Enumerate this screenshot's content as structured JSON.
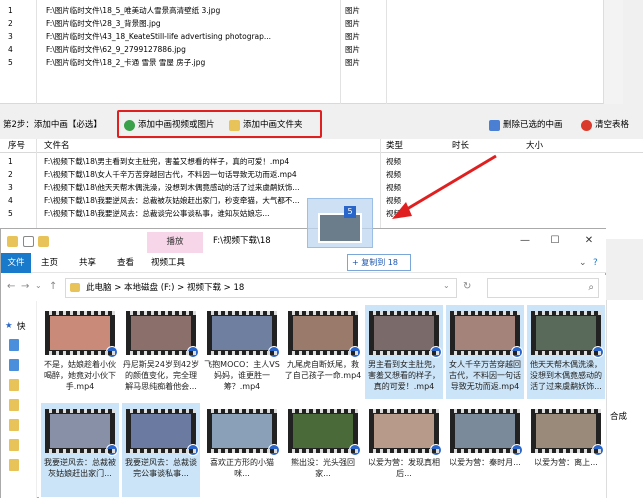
{
  "top_table": {
    "rows": [
      {
        "num": "1",
        "path": "F:\\图片临时文件\\18_5_唯美动人雪景高清壁纸 3.jpg",
        "type": "图片"
      },
      {
        "num": "2",
        "path": "F:\\图片临时文件\\28_3_背景图.jpg",
        "type": "图片"
      },
      {
        "num": "3",
        "path": "F:\\图片临时文件\\43_18_KeateStill-life advertising photograp...",
        "type": "图片"
      },
      {
        "num": "4",
        "path": "F:\\图片临时文件\\62_9_2799127886.jpg",
        "type": "图片"
      },
      {
        "num": "5",
        "path": "F:\\图片临时文件\\18_2_卡通 雪景 雪屋 房子.jpg",
        "type": "图片"
      }
    ]
  },
  "step2": {
    "label": "第2步：添加中画【必选】",
    "add_video_or_image": "添加中画视频或图片",
    "add_folder": "添加中画文件夹",
    "delete_selected": "删除已选的中画",
    "clear_table": "清空表格"
  },
  "bottom_table": {
    "headers": {
      "num": "序号",
      "name": "文件名",
      "type": "类型",
      "duration": "时长",
      "size": "大小"
    },
    "rows": [
      {
        "num": "1",
        "path": "F:\\视频下载\\18\\男主看到女主肚兜，害羞又想看的样子，真的可爱！.mp4",
        "type": "视频"
      },
      {
        "num": "2",
        "path": "F:\\视频下载\\18\\女人千辛万苦穿越回古代，不料因一句话导致无功而返.mp4",
        "type": "视频"
      },
      {
        "num": "3",
        "path": "F:\\视频下载\\18\\他天天帮木偶洗澡，没想到木偶竟感动的活了过来虞鹬妖饰...",
        "type": "视频"
      },
      {
        "num": "4",
        "path": "F:\\视频下载\\18\\我要逆风去：总裁被灰姑娘赶出家门，秒变牵猫，大气都不...",
        "type": "视频"
      },
      {
        "num": "5",
        "path": "F:\\视频下载\\18\\我要逆风去：总裁谈完公事谈私事，谁知灰姑娘忘...",
        "type": "视频"
      }
    ]
  },
  "drag": {
    "count": "5"
  },
  "explorer": {
    "play_tab": "播放",
    "title": "F:\\视频下载\\18",
    "tabs": {
      "file": "文件",
      "home": "主页",
      "share": "共享",
      "view": "查看",
      "video_tools": "视频工具"
    },
    "copy_hint": "+ 复制到 18",
    "breadcrumb": "此电脑  >  本地磁盘 (F:)  >  视频下载  >  18",
    "nav_label": "快",
    "files": [
      {
        "name": "不是，姑娘趁着小伙喝醉，她竟对小伙下手.mp4",
        "selected": false
      },
      {
        "name": "丹尼斯吴24岁到42岁的颜值变化，完全理解马思纯痴着他会...",
        "selected": false
      },
      {
        "name": "飞抱MOCO：主人VS妈妈，谁更胜一筹？.mp4",
        "selected": false
      },
      {
        "name": "九尾虎自断妖尾，救了自己孩子一命.mp4",
        "selected": false
      },
      {
        "name": "男主看到女主肚兜，害羞又想看的样子，真的可爱！.mp4",
        "selected": true
      },
      {
        "name": "女人千辛万苦穿越回古代，不料因一句话导致无功而返.mp4",
        "selected": true
      },
      {
        "name": "他天天帮木偶洗澡，没想到木偶竟感动的活了过来虞鹬妖饰...",
        "selected": true
      },
      {
        "name": "我要逆风去：总裁被灰姑娘赶出家门...",
        "selected": true
      },
      {
        "name": "我要逆风去：总裁谈完公事谈私事...",
        "selected": true
      },
      {
        "name": "喜欢正方形的小猫咪...",
        "selected": false
      },
      {
        "name": "熊出没：光头强回家...",
        "selected": false
      },
      {
        "name": "以爱为营：发现真相后...",
        "selected": false
      },
      {
        "name": "以爱为营：秦时月...",
        "selected": false
      },
      {
        "name": "以爱为营：离上...",
        "selected": false
      }
    ]
  },
  "right_edge": {
    "text": "合成"
  },
  "colors": {
    "highlight": "#e02020",
    "accent": "#1979ca",
    "selection": "#cce4f7",
    "play_tab": "#f8d6ea"
  }
}
